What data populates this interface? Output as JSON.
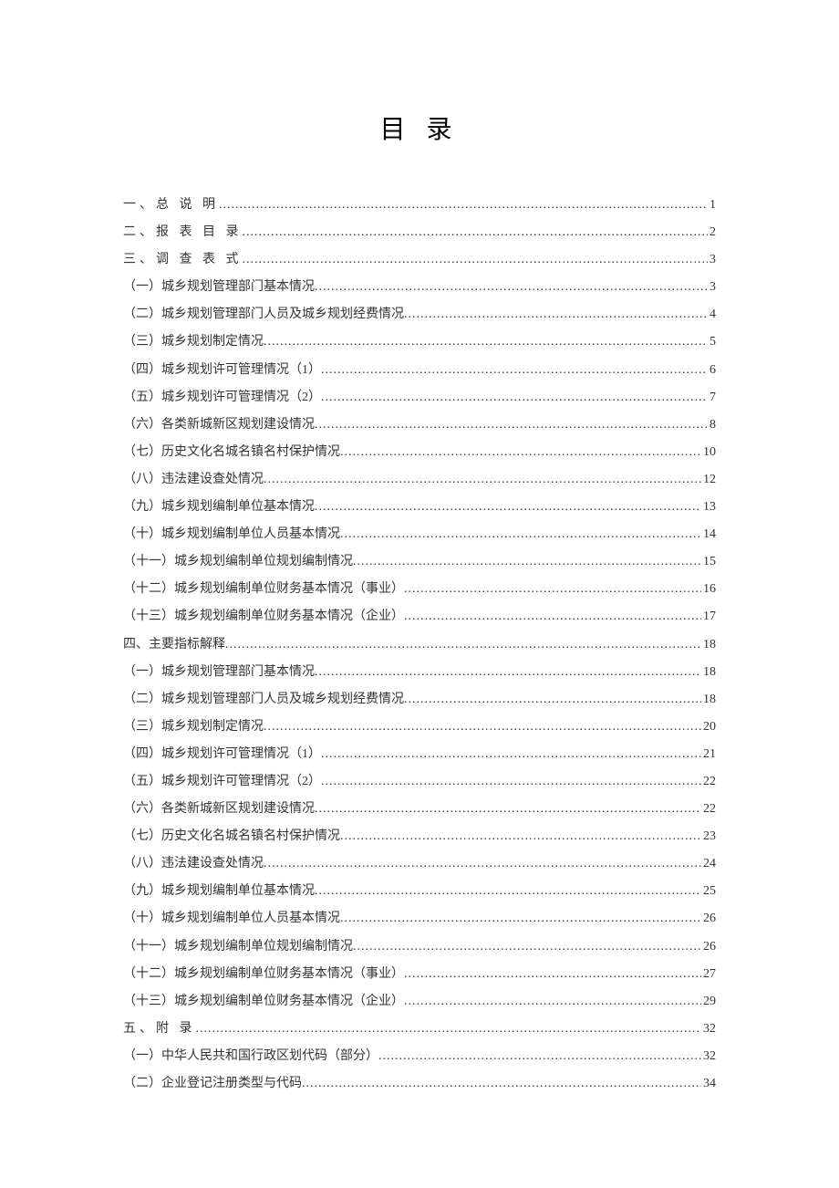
{
  "title": "目 录",
  "toc": [
    {
      "level": 1,
      "label": "一、总 说 明",
      "spaced": true,
      "page": "1"
    },
    {
      "level": 1,
      "label": "二、报 表 目 录",
      "spaced": true,
      "page": "2"
    },
    {
      "level": 1,
      "label": "三、调 查 表 式",
      "spaced": true,
      "page": "3"
    },
    {
      "level": 2,
      "label": "（一）城乡规划管理部门基本情况",
      "page": "3"
    },
    {
      "level": 2,
      "label": "（二）城乡规划管理部门人员及城乡规划经费情况",
      "page": "4"
    },
    {
      "level": 2,
      "label": "（三）城乡规划制定情况",
      "page": "5"
    },
    {
      "level": 2,
      "label": "（四）城乡规划许可管理情况（1）",
      "page": "6"
    },
    {
      "level": 2,
      "label": "（五）城乡规划许可管理情况（2）",
      "page": "7"
    },
    {
      "level": 2,
      "label": "（六）各类新城新区规划建设情况",
      "page": "8"
    },
    {
      "level": 2,
      "label": "（七）历史文化名城名镇名村保护情况",
      "page": "10"
    },
    {
      "level": 2,
      "label": "（八）违法建设查处情况",
      "page": "12"
    },
    {
      "level": 2,
      "label": "（九）城乡规划编制单位基本情况",
      "page": "13"
    },
    {
      "level": 2,
      "label": "（十）城乡规划编制单位人员基本情况",
      "page": "14"
    },
    {
      "level": 2,
      "label": "（十一）城乡规划编制单位规划编制情况",
      "page": "15"
    },
    {
      "level": 2,
      "label": "（十二）城乡规划编制单位财务基本情况（事业）",
      "page": "16"
    },
    {
      "level": 2,
      "label": "（十三）城乡规划编制单位财务基本情况（企业）",
      "page": "17"
    },
    {
      "level": 1,
      "label": "四、主要指标解释",
      "page": "18"
    },
    {
      "level": 2,
      "label": "（一）城乡规划管理部门基本情况",
      "page": "18"
    },
    {
      "level": 2,
      "label": "（二）城乡规划管理部门人员及城乡规划经费情况",
      "page": "18"
    },
    {
      "level": 2,
      "label": "（三）城乡规划制定情况",
      "page": "20"
    },
    {
      "level": 2,
      "label": "（四）城乡规划许可管理情况（1）",
      "page": "21"
    },
    {
      "level": 2,
      "label": "（五）城乡规划许可管理情况（2）",
      "page": "22"
    },
    {
      "level": 2,
      "label": "（六）各类新城新区规划建设情况",
      "page": "22"
    },
    {
      "level": 2,
      "label": "（七）历史文化名城名镇名村保护情况",
      "page": "23"
    },
    {
      "level": 2,
      "label": "（八）违法建设查处情况",
      "page": "24"
    },
    {
      "level": 2,
      "label": "（九）城乡规划编制单位基本情况",
      "page": "25"
    },
    {
      "level": 2,
      "label": "（十）城乡规划编制单位人员基本情况",
      "page": "26"
    },
    {
      "level": 2,
      "label": "（十一）城乡规划编制单位规划编制情况",
      "page": "26"
    },
    {
      "level": 2,
      "label": "（十二）城乡规划编制单位财务基本情况（事业）",
      "page": "27"
    },
    {
      "level": 2,
      "label": "（十三）城乡规划编制单位财务基本情况（企业）",
      "page": "29"
    },
    {
      "level": 1,
      "label": "五、附 录",
      "spaced": true,
      "page": "32"
    },
    {
      "level": 2,
      "label": "（一）中华人民共和国行政区划代码（部分）",
      "page": "32"
    },
    {
      "level": 2,
      "label": "（二）企业登记注册类型与代码",
      "page": "34"
    }
  ]
}
